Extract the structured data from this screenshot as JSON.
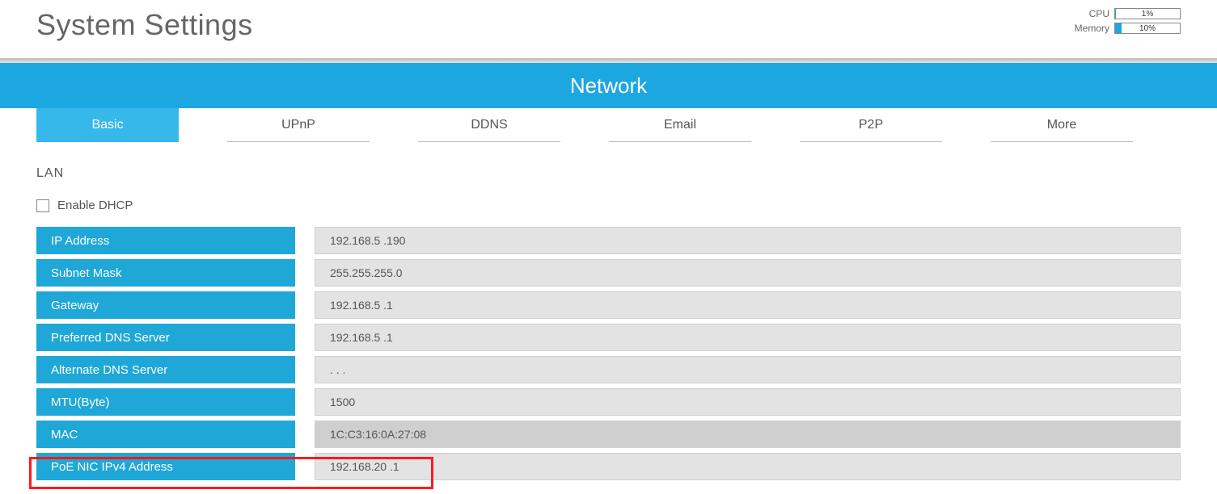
{
  "header": {
    "title": "System Settings",
    "stats": {
      "cpu_label": "CPU",
      "cpu_pct": "1%",
      "cpu_fill": 1,
      "mem_label": "Memory",
      "mem_pct": "10%",
      "mem_fill": 10
    }
  },
  "banner": {
    "title": "Network"
  },
  "tabs": [
    {
      "label": "Basic",
      "active": true
    },
    {
      "label": "UPnP",
      "active": false
    },
    {
      "label": "DDNS",
      "active": false
    },
    {
      "label": "Email",
      "active": false
    },
    {
      "label": "P2P",
      "active": false
    },
    {
      "label": "More",
      "active": false
    }
  ],
  "section": {
    "lan_label": "LAN",
    "dhcp_label": "Enable DHCP",
    "dhcp_checked": false
  },
  "rows": [
    {
      "label": "IP Address",
      "value": "192.168.5 .190",
      "dark": false
    },
    {
      "label": "Subnet Mask",
      "value": "255.255.255.0",
      "dark": false
    },
    {
      "label": "Gateway",
      "value": "192.168.5 .1",
      "dark": false
    },
    {
      "label": "Preferred DNS Server",
      "value": "192.168.5 .1",
      "dark": false
    },
    {
      "label": "Alternate DNS Server",
      "value": " .  .  .",
      "dark": false
    },
    {
      "label": "MTU(Byte)",
      "value": "1500",
      "dark": false
    },
    {
      "label": "MAC",
      "value": "1C:C3:16:0A:27:08",
      "dark": true
    },
    {
      "label": "PoE NIC IPv4 Address",
      "value": "192.168.20 .1",
      "dark": false
    }
  ],
  "colors": {
    "accent": "#1da7e0",
    "field_bg": "#e3e3e3",
    "label_bg": "#1ea7d7"
  }
}
